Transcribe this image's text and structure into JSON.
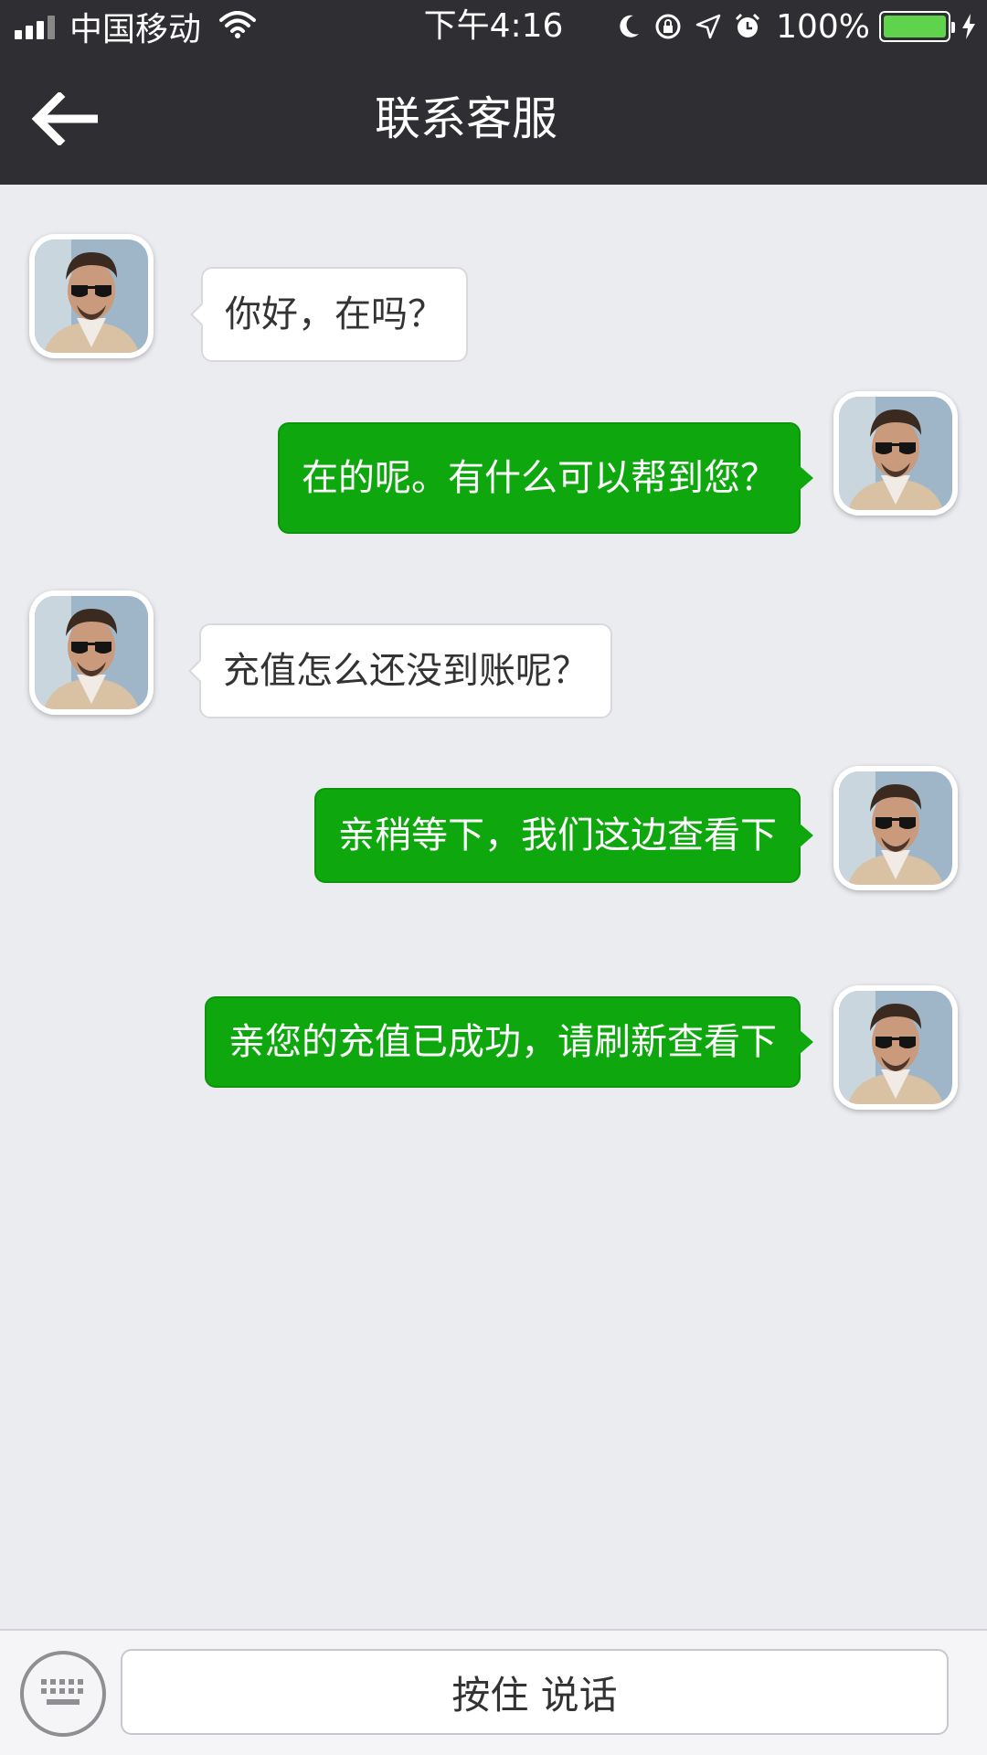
{
  "status_bar": {
    "carrier": "中国移动",
    "time": "下午4:16",
    "battery": "100%"
  },
  "nav": {
    "title": "联系客服"
  },
  "messages": [
    {
      "side": "in",
      "text": "你好，在吗？"
    },
    {
      "side": "out",
      "text": "在的呢。有什么可以帮到您？"
    },
    {
      "side": "in",
      "text": "充值怎么还没到账呢？"
    },
    {
      "side": "out",
      "text": "亲稍等下，我们这边查看下"
    },
    {
      "side": "out",
      "text": "亲您的充值已成功，请刷新查看下"
    }
  ],
  "input_bar": {
    "hold_to_talk_label": "按住 说话"
  },
  "colors": {
    "header_bg": "#2e2e33",
    "chat_bg": "#ebecf0",
    "outgoing_bubble": "#0ea80e",
    "incoming_bubble": "#ffffff"
  }
}
